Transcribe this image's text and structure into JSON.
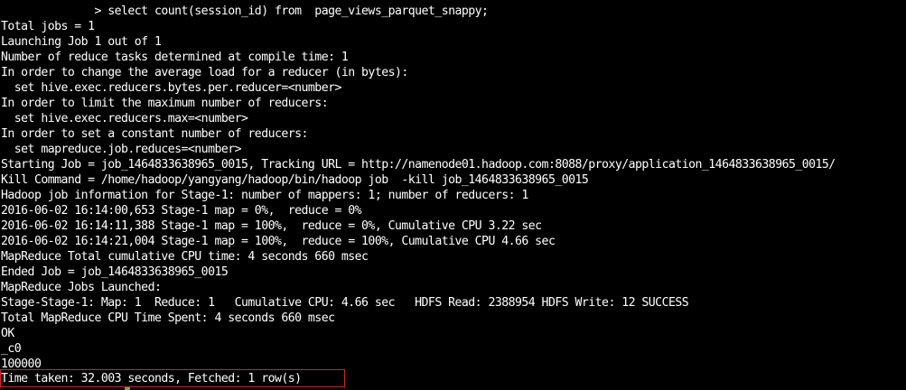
{
  "terminal": {
    "background": "#000000",
    "text_color": "#ffffff",
    "highlight_color": "#d2232a",
    "cursor_color": "#33cc33",
    "lines": [
      "              > select count(session_id) from  page_views_parquet_snappy;",
      "Total jobs = 1",
      "Launching Job 1 out of 1",
      "Number of reduce tasks determined at compile time: 1",
      "In order to change the average load for a reducer (in bytes):",
      "  set hive.exec.reducers.bytes.per.reducer=<number>",
      "In order to limit the maximum number of reducers:",
      "  set hive.exec.reducers.max=<number>",
      "In order to set a constant number of reducers:",
      "  set mapreduce.job.reduces=<number>",
      "Starting Job = job_1464833638965_0015, Tracking URL = http://namenode01.hadoop.com:8088/proxy/application_1464833638965_0015/",
      "Kill Command = /home/hadoop/yangyang/hadoop/bin/hadoop job  -kill job_1464833638965_0015",
      "Hadoop job information for Stage-1: number of mappers: 1; number of reducers: 1",
      "2016-06-02 16:14:00,653 Stage-1 map = 0%,  reduce = 0%",
      "2016-06-02 16:14:11,388 Stage-1 map = 100%,  reduce = 0%, Cumulative CPU 3.22 sec",
      "2016-06-02 16:14:21,004 Stage-1 map = 100%,  reduce = 100%, Cumulative CPU 4.66 sec",
      "MapReduce Total cumulative CPU time: 4 seconds 660 msec",
      "Ended Job = job_1464833638965_0015",
      "MapReduce Jobs Launched:",
      "Stage-Stage-1: Map: 1  Reduce: 1   Cumulative CPU: 4.66 sec   HDFS Read: 2388954 HDFS Write: 12 SUCCESS",
      "Total MapReduce CPU Time Spent: 4 seconds 660 msec",
      "OK",
      "_c0",
      "100000",
      "Time taken: 32.003 seconds, Fetched: 1 row(s)"
    ]
  }
}
